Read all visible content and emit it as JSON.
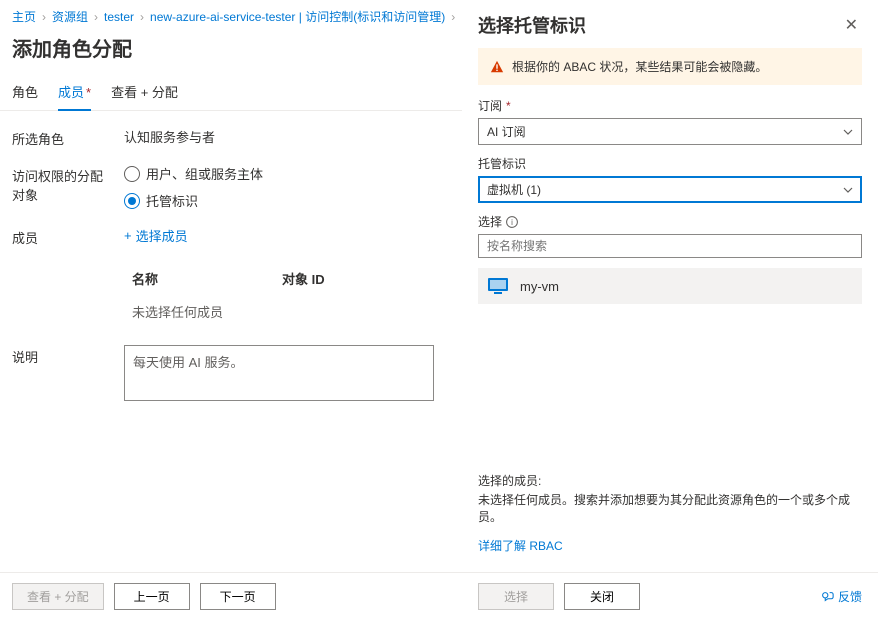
{
  "breadcrumb": {
    "home": "主页",
    "rg": "资源组",
    "tester": "tester",
    "service": "new-azure-ai-service-tester | 访问控制(标识和访问管理)"
  },
  "page_title": "添加角色分配",
  "tabs": {
    "role": "角色",
    "members": "成员",
    "review": "查看 + 分配"
  },
  "form": {
    "selected_role_label": "所选角色",
    "selected_role_value": "认知服务参与者",
    "assign_label": "访问权限的分配对象",
    "radio_user": "用户、组或服务主体",
    "radio_mi": "托管标识",
    "members_label": "成员",
    "select_members": "选择成员",
    "table_name": "名称",
    "table_oid": "对象 ID",
    "table_empty": "未选择任何成员",
    "desc_label": "说明",
    "desc_value": "每天使用 AI 服务。"
  },
  "footer": {
    "review": "查看 + 分配",
    "prev": "上一页",
    "next": "下一页"
  },
  "panel": {
    "title": "选择托管标识",
    "alert": "根据你的 ABAC 状况，某些结果可能会被隐藏。",
    "sub_label": "订阅",
    "sub_value": "AI 订阅",
    "mi_label": "托管标识",
    "mi_value": "虚拟机 (1)",
    "select_label": "选择",
    "search_placeholder": "按名称搜索",
    "result_name": "my-vm",
    "selected_members_label": "选择的成员:",
    "selected_members_msg": "未选择任何成员。搜索并添加想要为其分配此资源角色的一个或多个成员。",
    "rbac_link": "详细了解 RBAC",
    "btn_select": "选择",
    "btn_close": "关闭",
    "feedback": "反馈"
  }
}
